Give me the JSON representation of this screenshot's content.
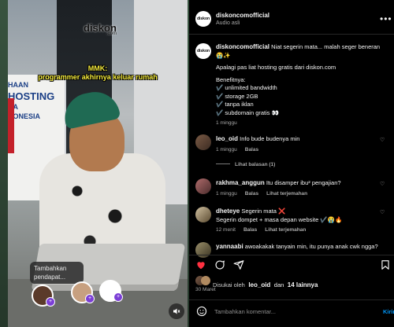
{
  "video": {
    "overlay_logo": "diskon",
    "overlay_logo_sub": ".com",
    "meme_caption_line1": "MMK:",
    "meme_caption_line2": "programmer akhirnya keluar rumah",
    "banner_lines": [
      "HAAN",
      "HOSTING",
      "NA",
      "DONESIA"
    ],
    "tooltip": "Tambahkan pendapat..."
  },
  "post": {
    "username": "diskoncomofficial",
    "audio": "Audio asli",
    "caption_user": "diskoncomofficial",
    "caption_line1": "Niat segerin mata... malah seger beneran 😭✨",
    "caption_line2": "Apalagi pas liat hosting gratis dari diskon.com",
    "benefits_title": "Benefitnya:",
    "benefits": [
      "✔️ unlimited bandwidth",
      "✔️ storage 2GB",
      "✔️ tanpa iklan",
      "✔️ subdomain gratis 👀"
    ],
    "time": "1 minggu"
  },
  "comments": [
    {
      "user": "leo_oid",
      "text": "Info bude budenya min",
      "time": "1 minggu",
      "reply": "Balas",
      "view_replies": "Lihat balasan (1)"
    },
    {
      "user": "rakhma_anggun",
      "text": "Itu disamper ibu² pengajian?",
      "time": "1 minggu",
      "reply": "Balas",
      "translate": "Lihat terjemahan"
    },
    {
      "user": "dheteye",
      "text": "Segerin mata ❌",
      "text2": "Segerin dompet + masa depan website ✔️😭🔥",
      "time": "12 menit",
      "reply": "Balas",
      "translate": "Lihat terjemahan"
    },
    {
      "user": "yannaabi",
      "text": "awoakakak tanyain min, itu punya anak cwk ngga?"
    }
  ],
  "likes": {
    "prefix": "Disukai oleh",
    "user": "leo_oid",
    "and": "dan",
    "others": "14 lainnya",
    "date": "30 Maret"
  },
  "composer": {
    "placeholder": "Tambahkan komentar...",
    "post_label": "Kirim"
  },
  "icons": [
    "heart-icon",
    "comment-icon",
    "share-icon",
    "bookmark-icon",
    "emoji-icon",
    "more-icon",
    "mute-icon"
  ]
}
